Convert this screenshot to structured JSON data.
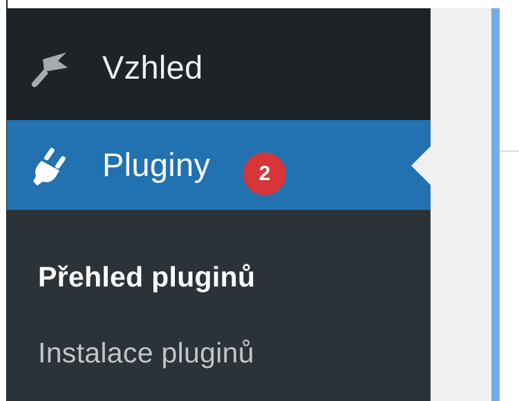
{
  "sidebar": {
    "items": [
      {
        "label": "Vzhled",
        "icon": "paintbrush-icon",
        "current": false
      },
      {
        "label": "Pluginy",
        "icon": "plugin-icon",
        "current": true,
        "badge": "2"
      }
    ],
    "submenu": [
      {
        "label": "Přehled pluginů",
        "current": true
      },
      {
        "label": "Instalace pluginů",
        "current": false
      }
    ]
  },
  "colors": {
    "sidebar_bg": "#2c3338",
    "sidebar_dark": "#1d2327",
    "accent": "#2271b1",
    "badge": "#d63638",
    "notice_border": "#72aee6"
  }
}
